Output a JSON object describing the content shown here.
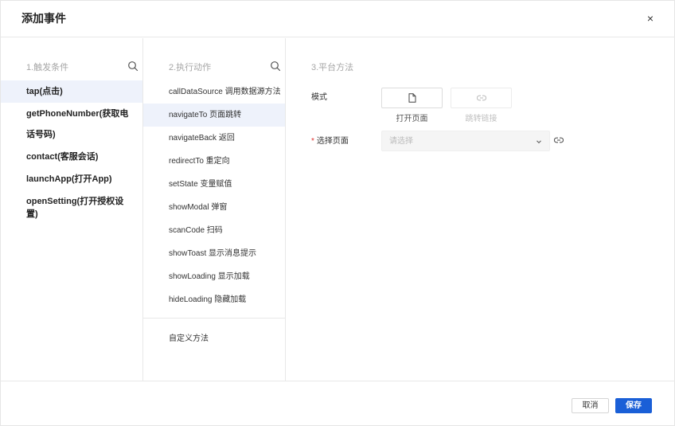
{
  "dialog": {
    "title": "添加事件",
    "close_icon": "close-icon",
    "close_glyph": "×"
  },
  "trigger": {
    "title": "1.触发条件",
    "search_icon": "search-icon",
    "items": [
      {
        "label": "tap(点击)",
        "active": true
      },
      {
        "label": "getPhoneNumber(获取电话号码)",
        "active": false
      },
      {
        "label": "contact(客服会话)",
        "active": false
      },
      {
        "label": "launchApp(打开App)",
        "active": false
      },
      {
        "label": "openSetting(打开授权设置)",
        "active": false
      }
    ]
  },
  "action": {
    "title": "2.执行动作",
    "search_icon": "search-icon",
    "items": [
      {
        "label": "callDataSource 调用数据源方法",
        "active": false
      },
      {
        "label": "navigateTo 页面跳转",
        "active": true
      },
      {
        "label": "navigateBack 返回",
        "active": false
      },
      {
        "label": "redirectTo 重定向",
        "active": false
      },
      {
        "label": "setState 变量赋值",
        "active": false
      },
      {
        "label": "showModal 弹窗",
        "active": false
      },
      {
        "label": "scanCode 扫码",
        "active": false
      },
      {
        "label": "showToast 显示消息提示",
        "active": false
      },
      {
        "label": "showLoading 显示加载",
        "active": false
      },
      {
        "label": "hideLoading 隐藏加载",
        "active": false
      }
    ],
    "custom_label": "自定义方法"
  },
  "platform": {
    "title": "3.平台方法",
    "mode_label": "模式",
    "modes": [
      {
        "label": "打开页面",
        "icon": "file-icon",
        "selected": true,
        "disabled": false
      },
      {
        "label": "跳转链接",
        "icon": "link-icon",
        "selected": false,
        "disabled": true
      }
    ],
    "page_label": "选择页面",
    "required_mark": "*",
    "page_placeholder": "请选择",
    "dropdown_icon": "chevron-down-icon",
    "side_icon": "link-icon"
  },
  "footer": {
    "cancel_label": "取消",
    "save_label": "保存"
  },
  "colors": {
    "primary": "#1a5fd7",
    "active_row": "#eef2fb",
    "required": "#e0302d"
  }
}
